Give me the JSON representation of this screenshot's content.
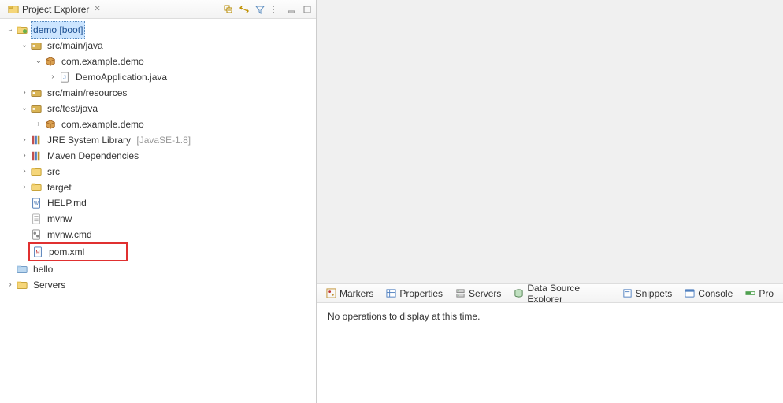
{
  "explorer": {
    "title": "Project Explorer",
    "tree": {
      "demo": {
        "label": "demo",
        "suffix": "[boot]"
      },
      "src_main_java": "src/main/java",
      "pkg_main": "com.example.demo",
      "demo_app": "DemoApplication.java",
      "src_main_res": "src/main/resources",
      "src_test_java": "src/test/java",
      "pkg_test": "com.example.demo",
      "jre": {
        "label": "JRE System Library",
        "suffix": "[JavaSE-1.8]"
      },
      "maven_deps": "Maven Dependencies",
      "src": "src",
      "target": "target",
      "help_md": "HELP.md",
      "mvnw": "mvnw",
      "mvnw_cmd": "mvnw.cmd",
      "pom_xml": "pom.xml",
      "hello": "hello",
      "servers": "Servers"
    }
  },
  "views": {
    "markers": "Markers",
    "properties": "Properties",
    "servers": "Servers",
    "data_source": "Data Source Explorer",
    "snippets": "Snippets",
    "console": "Console",
    "progress_partial": "Pro"
  },
  "progress": {
    "empty_message": "No operations to display at this time."
  }
}
